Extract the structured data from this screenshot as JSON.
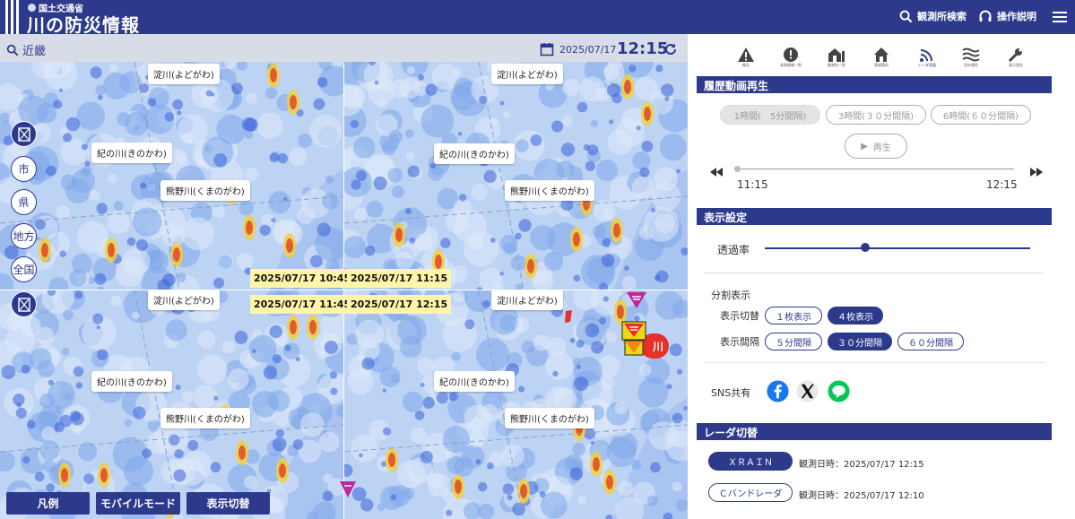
{
  "header": {
    "ministry": "国土交通省",
    "title": "川の防災情報",
    "search_label": "観測所検索",
    "help_label": "操作説明"
  },
  "subbar": {
    "region": "近畿",
    "date": "2025/07/17",
    "time": "12:15"
  },
  "map": {
    "side_buttons": [
      "市",
      "県",
      "地方",
      "全国"
    ],
    "panes": [
      {
        "timestamp": "2025/07/17 10:45",
        "rivers": [
          "淀川(よどがわ)",
          "紀の川(きのかわ)",
          "熊野川(くまのがわ)"
        ]
      },
      {
        "timestamp": "2025/07/17 11:15",
        "rivers": [
          "淀川(よどがわ)",
          "紀の川(きのかわ)",
          "熊野川(くまのがわ)"
        ]
      },
      {
        "timestamp": "2025/07/17 11:45",
        "rivers": [
          "淀川(よどがわ)",
          "紀の川(きのかわ)",
          "熊野川(くまのがわ)"
        ]
      },
      {
        "timestamp": "2025/07/17 12:15",
        "rivers": [
          "淀川(よどがわ)",
          "紀の川(きのかわ)",
          "熊野川(くまのがわ)"
        ]
      }
    ],
    "warning_label": "川",
    "bottom_buttons": [
      "凡例",
      "モバイルモード",
      "表示切替"
    ]
  },
  "toolbar": [
    {
      "icon": "warning-icon",
      "label": "概況"
    },
    {
      "icon": "alert-list-icon",
      "label": "発表情報一覧"
    },
    {
      "icon": "station-list-icon",
      "label": "観測所一覧"
    },
    {
      "icon": "home-icon",
      "label": "登録箇所"
    },
    {
      "icon": "radar-icon",
      "label": "レーダ雨量"
    },
    {
      "icon": "flood-icon",
      "label": "浸水想定"
    },
    {
      "icon": "tools-icon",
      "label": "表示設定"
    }
  ],
  "history": {
    "heading": "履歴動画再生",
    "ranges": [
      "1時間(　5分間隔)",
      "3時間(３０分間隔)",
      "6時間(６０分間隔)"
    ],
    "play_label": "再生",
    "start_time": "11:15",
    "end_time": "12:15"
  },
  "display": {
    "heading": "表示設定",
    "opacity_label": "透過率",
    "opacity_value": 0.38,
    "split_label": "分割表示",
    "switch_label": "表示切替",
    "switch_options": [
      "１枚表示",
      "４枚表示"
    ],
    "interval_label": "表示間隔",
    "interval_options": [
      "５分間隔",
      "３０分間隔",
      "６０分間隔"
    ],
    "sns_label": "SNS共有"
  },
  "radar": {
    "heading": "レーダ切替",
    "options": [
      {
        "name": "ＸＲＡＩＮ",
        "time": "観測日時：2025/07/17 12:15"
      },
      {
        "name": "Ｃバンドレーダ",
        "time": "観測日時：2025/07/17 12:10"
      }
    ]
  },
  "colors": {
    "brand": "#2d3a8c",
    "timestamp_bg": "#fff5a8",
    "warning": "#e8302a"
  }
}
